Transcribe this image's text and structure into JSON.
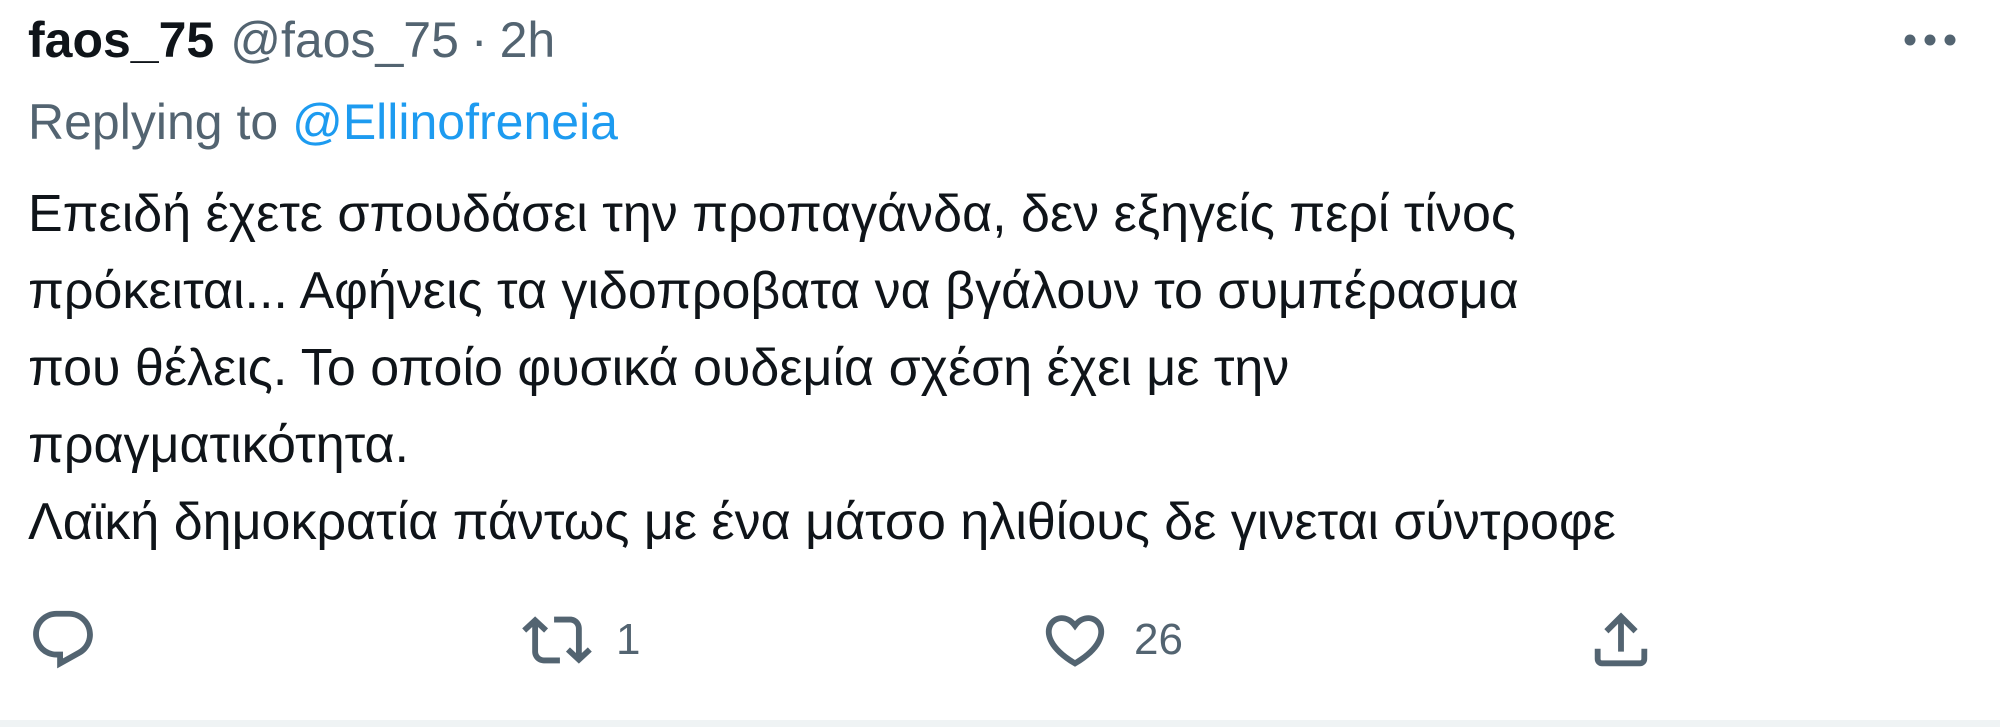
{
  "tweet": {
    "display_name": "faos_75",
    "handle": "@faos_75",
    "separator": "·",
    "time": "2h",
    "replying_prefix": "Replying to",
    "replying_to": "@Ellinofreneia",
    "body_lines": [
      "Επειδή έχετε σπουδάσει την προπαγάνδα, δεν εξηγείς περί τίνος",
      "πρόκειται... Αφήνεις τα γιδοπροβατα να βγάλουν το συμπέρασμα",
      "που θέλεις. Το οποίο φυσικά ουδεμία σχέση έχει με την",
      "πραγματικότητα.",
      "Λαϊκή δημοκρατία πάντως με ένα μάτσο ηλιθίους δε γινεται σύντροφε"
    ],
    "actions": {
      "reply_icon": "reply-icon",
      "retweet_icon": "retweet-icon",
      "retweet_count": "1",
      "like_icon": "heart-icon",
      "like_count": "26",
      "share_icon": "share-icon"
    },
    "more_icon": "more-icon"
  },
  "colors": {
    "text_primary": "#0f1419",
    "text_secondary": "#536471",
    "link": "#1d9bf0",
    "divider": "#eff3f4"
  }
}
